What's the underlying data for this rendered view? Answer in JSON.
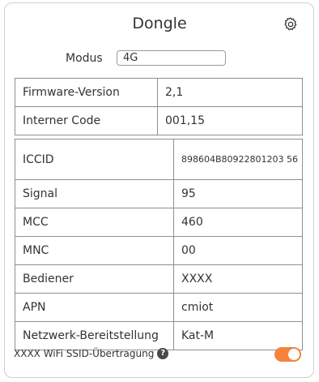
{
  "header": {
    "title": "Dongle",
    "settings_icon": "gear-icon"
  },
  "mode": {
    "label": "Modus",
    "value": "4G"
  },
  "info_table": [
    {
      "key": "Firmware-Version",
      "value": "2,1"
    },
    {
      "key": "Interner Code",
      "value": "001,15"
    }
  ],
  "network_table": [
    {
      "key": "ICCID",
      "value": "898604B80922801203 56"
    },
    {
      "key": "Signal",
      "value": "95"
    },
    {
      "key": "MCC",
      "value": "460"
    },
    {
      "key": "MNC",
      "value": "00"
    },
    {
      "key": "Bediener",
      "value": "XXXX"
    },
    {
      "key": "APN",
      "value": "cmiot"
    },
    {
      "key": "Netzwerk-Bereitstellung",
      "value": "Kat-M"
    }
  ],
  "wifi": {
    "label": "XXXX WiFi SSID-Übertragung",
    "help_icon": "question-icon",
    "help_glyph": "?",
    "enabled": true,
    "accent_color": "#f4843b"
  }
}
